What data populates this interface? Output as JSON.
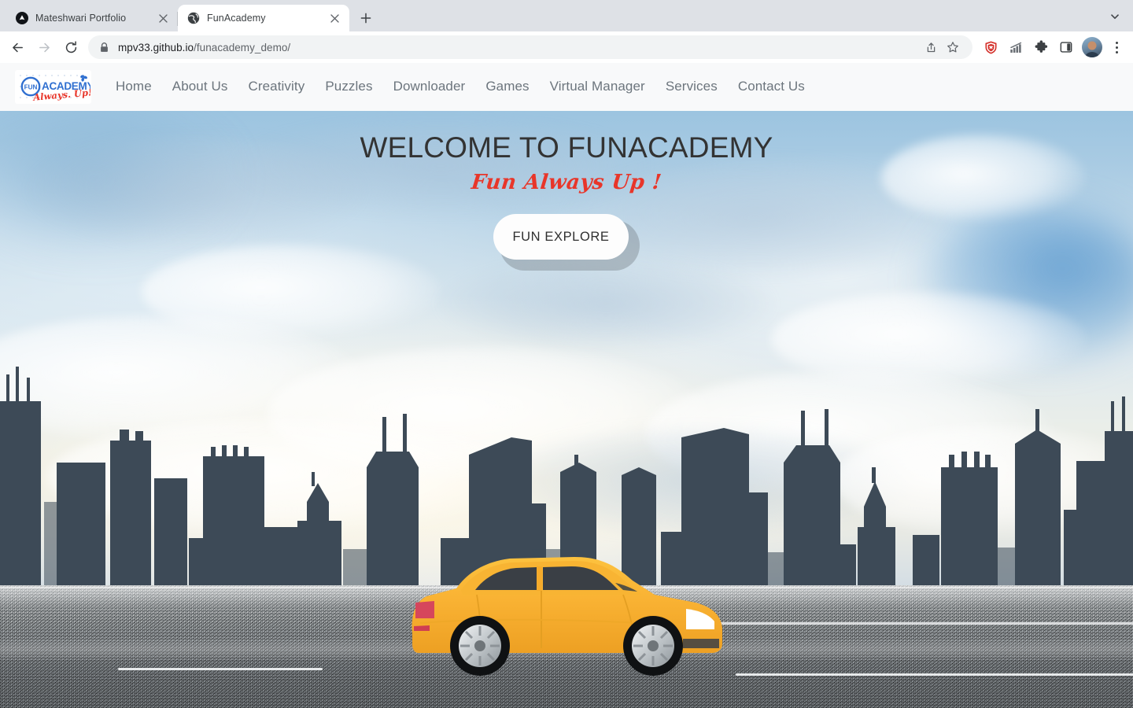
{
  "browser": {
    "tabs": [
      {
        "title": "Mateshwari Portfolio",
        "favicon": "triangle-dark-icon",
        "active": false
      },
      {
        "title": "FunAcademy",
        "favicon": "globe-icon",
        "active": true
      }
    ],
    "new_tab_label": "+",
    "tab_list_icon": "chevron-down-icon",
    "toolbar": {
      "back_icon": "back-arrow-icon",
      "forward_icon": "forward-arrow-icon",
      "reload_icon": "reload-icon",
      "lock_icon": "lock-icon",
      "url_domain": "mpv33.github.io",
      "url_path": "/funacademy_demo/",
      "share_icon": "share-icon",
      "bookmark_icon": "star-icon",
      "extensions": [
        {
          "name": "ublock-shield-icon",
          "color": "#d4302a"
        },
        {
          "name": "analytics-chart-icon",
          "color": "#6a6f75"
        },
        {
          "name": "puzzle-extensions-icon",
          "color": "#3c4043"
        },
        {
          "name": "side-panel-icon",
          "color": "#3c4043"
        }
      ],
      "avatar_name": "profile-avatar",
      "menu_icon": "three-dot-menu-icon"
    }
  },
  "site": {
    "logo": {
      "word_fun": "FUN",
      "word_academy": "ACADEMY",
      "tagline": "Always. Up!",
      "color_blue": "#2f6fd0",
      "color_red": "#e8362a"
    },
    "nav": [
      {
        "label": "Home"
      },
      {
        "label": "About Us"
      },
      {
        "label": "Creativity"
      },
      {
        "label": "Puzzles"
      },
      {
        "label": "Downloader"
      },
      {
        "label": "Games"
      },
      {
        "label": "Virtual Manager"
      },
      {
        "label": "Services"
      },
      {
        "label": "Contact Us"
      }
    ],
    "hero": {
      "title": "WELCOME TO FUNACADEMY",
      "subtitle": "Fun Always Up !",
      "cta_label": "FUN EXPLORE",
      "title_color": "#333333",
      "subtitle_color": "#e8362a",
      "scene": {
        "sky": "cloudy-blue-sky",
        "skyline": "city-skyline-silhouette",
        "skyline_color": "#3d4a57",
        "road": "asphalt-road",
        "car": "yellow-hatchback-car",
        "car_color": "#f9b233"
      }
    }
  }
}
